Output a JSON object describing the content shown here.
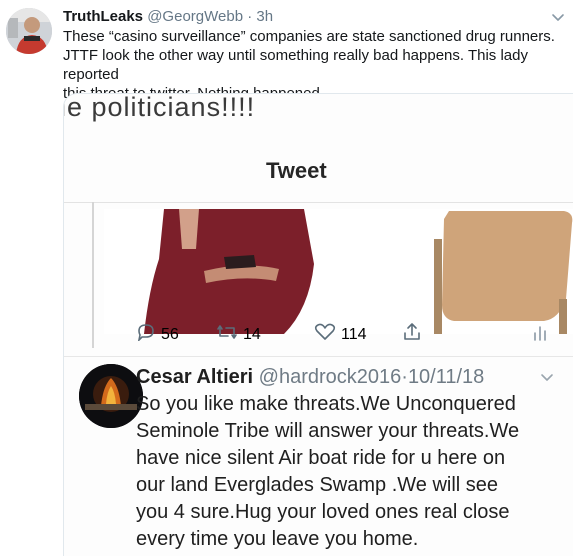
{
  "tweet": {
    "author_name": "TruthLeaks",
    "author_handle": "@GeorgWebb",
    "separator": "·",
    "time": "3h",
    "text_lines": [
      "These “casino surveillance” companies are state sanctioned drug runners.",
      "JTTF look the other way until something really bad happens. This lady reported",
      "this threat to twitter. Nothing happened."
    ]
  },
  "screenshot": {
    "cropped_heading": "ie politicians!!!!",
    "title": "Tweet",
    "actions": {
      "reply_count": "56",
      "retweet_count": "14",
      "like_count": "114"
    },
    "reply": {
      "author_name": "Cesar Altieri",
      "author_handle": "@hardrock2016",
      "separator": "·",
      "date": "10/11/18",
      "text_lines": [
        "So you like make threats.We Unconquered",
        "Seminole Tribe will answer your threats.We",
        "have nice silent Air boat ride for u here on",
        "our land Everglades Swamp .We will see",
        "you 4 sure.Hug your loved ones real close",
        "every time you leave you home."
      ]
    }
  },
  "colors": {
    "text_primary": "#14171a",
    "text_secondary": "#657786",
    "card_border": "#e1e8ed"
  },
  "icons": [
    "avatar",
    "chevron-down-icon",
    "reply-icon",
    "retweet-icon",
    "like-icon",
    "share-icon",
    "analytics-icon"
  ]
}
